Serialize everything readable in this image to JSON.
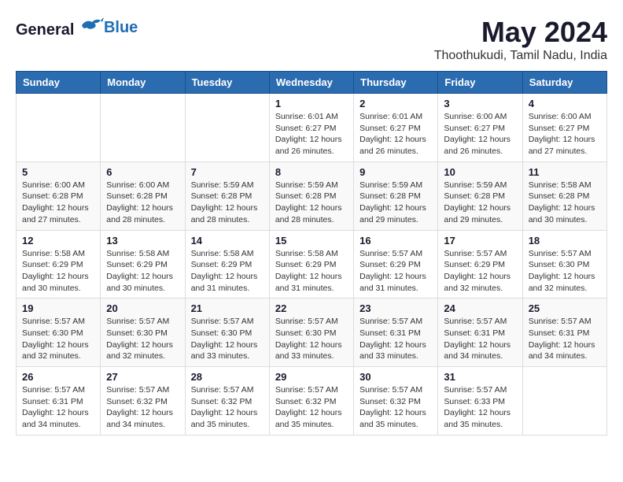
{
  "header": {
    "logo_general": "General",
    "logo_blue": "Blue",
    "month_title": "May 2024",
    "location": "Thoothukudi, Tamil Nadu, India"
  },
  "calendar": {
    "days_of_week": [
      "Sunday",
      "Monday",
      "Tuesday",
      "Wednesday",
      "Thursday",
      "Friday",
      "Saturday"
    ],
    "weeks": [
      [
        {
          "day": "",
          "info": ""
        },
        {
          "day": "",
          "info": ""
        },
        {
          "day": "",
          "info": ""
        },
        {
          "day": "1",
          "info": "Sunrise: 6:01 AM\nSunset: 6:27 PM\nDaylight: 12 hours\nand 26 minutes."
        },
        {
          "day": "2",
          "info": "Sunrise: 6:01 AM\nSunset: 6:27 PM\nDaylight: 12 hours\nand 26 minutes."
        },
        {
          "day": "3",
          "info": "Sunrise: 6:00 AM\nSunset: 6:27 PM\nDaylight: 12 hours\nand 26 minutes."
        },
        {
          "day": "4",
          "info": "Sunrise: 6:00 AM\nSunset: 6:27 PM\nDaylight: 12 hours\nand 27 minutes."
        }
      ],
      [
        {
          "day": "5",
          "info": "Sunrise: 6:00 AM\nSunset: 6:28 PM\nDaylight: 12 hours\nand 27 minutes."
        },
        {
          "day": "6",
          "info": "Sunrise: 6:00 AM\nSunset: 6:28 PM\nDaylight: 12 hours\nand 28 minutes."
        },
        {
          "day": "7",
          "info": "Sunrise: 5:59 AM\nSunset: 6:28 PM\nDaylight: 12 hours\nand 28 minutes."
        },
        {
          "day": "8",
          "info": "Sunrise: 5:59 AM\nSunset: 6:28 PM\nDaylight: 12 hours\nand 28 minutes."
        },
        {
          "day": "9",
          "info": "Sunrise: 5:59 AM\nSunset: 6:28 PM\nDaylight: 12 hours\nand 29 minutes."
        },
        {
          "day": "10",
          "info": "Sunrise: 5:59 AM\nSunset: 6:28 PM\nDaylight: 12 hours\nand 29 minutes."
        },
        {
          "day": "11",
          "info": "Sunrise: 5:58 AM\nSunset: 6:28 PM\nDaylight: 12 hours\nand 30 minutes."
        }
      ],
      [
        {
          "day": "12",
          "info": "Sunrise: 5:58 AM\nSunset: 6:29 PM\nDaylight: 12 hours\nand 30 minutes."
        },
        {
          "day": "13",
          "info": "Sunrise: 5:58 AM\nSunset: 6:29 PM\nDaylight: 12 hours\nand 30 minutes."
        },
        {
          "day": "14",
          "info": "Sunrise: 5:58 AM\nSunset: 6:29 PM\nDaylight: 12 hours\nand 31 minutes."
        },
        {
          "day": "15",
          "info": "Sunrise: 5:58 AM\nSunset: 6:29 PM\nDaylight: 12 hours\nand 31 minutes."
        },
        {
          "day": "16",
          "info": "Sunrise: 5:57 AM\nSunset: 6:29 PM\nDaylight: 12 hours\nand 31 minutes."
        },
        {
          "day": "17",
          "info": "Sunrise: 5:57 AM\nSunset: 6:29 PM\nDaylight: 12 hours\nand 32 minutes."
        },
        {
          "day": "18",
          "info": "Sunrise: 5:57 AM\nSunset: 6:30 PM\nDaylight: 12 hours\nand 32 minutes."
        }
      ],
      [
        {
          "day": "19",
          "info": "Sunrise: 5:57 AM\nSunset: 6:30 PM\nDaylight: 12 hours\nand 32 minutes."
        },
        {
          "day": "20",
          "info": "Sunrise: 5:57 AM\nSunset: 6:30 PM\nDaylight: 12 hours\nand 32 minutes."
        },
        {
          "day": "21",
          "info": "Sunrise: 5:57 AM\nSunset: 6:30 PM\nDaylight: 12 hours\nand 33 minutes."
        },
        {
          "day": "22",
          "info": "Sunrise: 5:57 AM\nSunset: 6:30 PM\nDaylight: 12 hours\nand 33 minutes."
        },
        {
          "day": "23",
          "info": "Sunrise: 5:57 AM\nSunset: 6:31 PM\nDaylight: 12 hours\nand 33 minutes."
        },
        {
          "day": "24",
          "info": "Sunrise: 5:57 AM\nSunset: 6:31 PM\nDaylight: 12 hours\nand 34 minutes."
        },
        {
          "day": "25",
          "info": "Sunrise: 5:57 AM\nSunset: 6:31 PM\nDaylight: 12 hours\nand 34 minutes."
        }
      ],
      [
        {
          "day": "26",
          "info": "Sunrise: 5:57 AM\nSunset: 6:31 PM\nDaylight: 12 hours\nand 34 minutes."
        },
        {
          "day": "27",
          "info": "Sunrise: 5:57 AM\nSunset: 6:32 PM\nDaylight: 12 hours\nand 34 minutes."
        },
        {
          "day": "28",
          "info": "Sunrise: 5:57 AM\nSunset: 6:32 PM\nDaylight: 12 hours\nand 35 minutes."
        },
        {
          "day": "29",
          "info": "Sunrise: 5:57 AM\nSunset: 6:32 PM\nDaylight: 12 hours\nand 35 minutes."
        },
        {
          "day": "30",
          "info": "Sunrise: 5:57 AM\nSunset: 6:32 PM\nDaylight: 12 hours\nand 35 minutes."
        },
        {
          "day": "31",
          "info": "Sunrise: 5:57 AM\nSunset: 6:33 PM\nDaylight: 12 hours\nand 35 minutes."
        },
        {
          "day": "",
          "info": ""
        }
      ]
    ]
  }
}
